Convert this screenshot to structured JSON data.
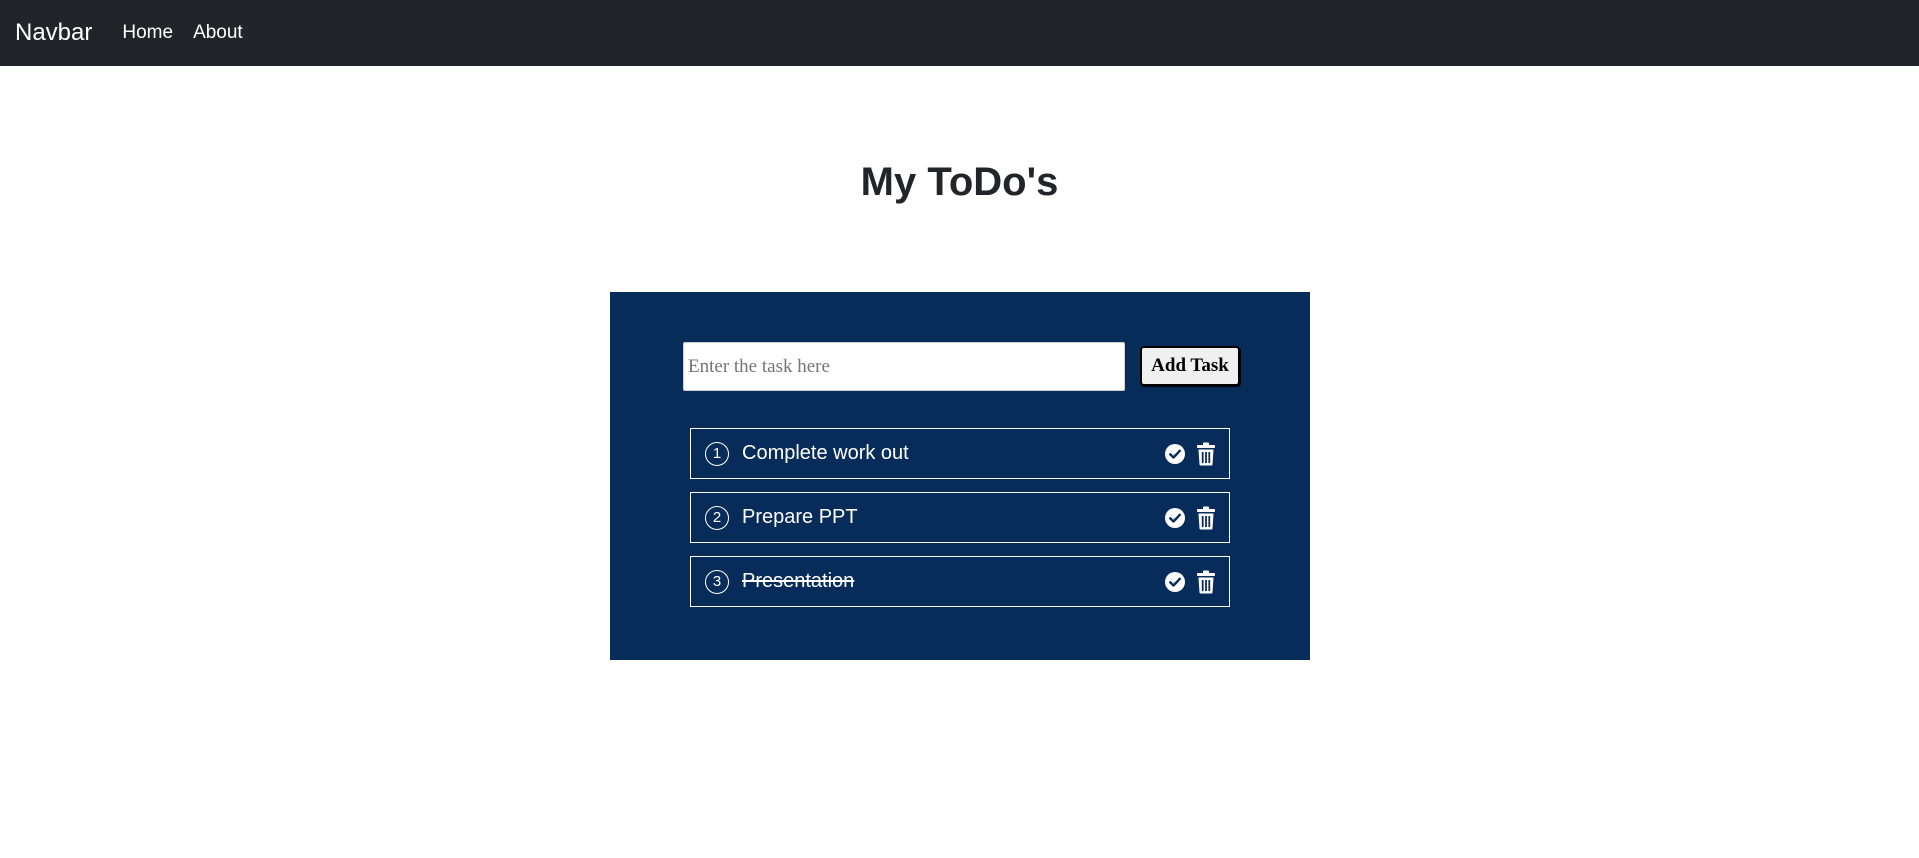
{
  "navbar": {
    "brand": "Navbar",
    "links": [
      "Home",
      "About"
    ],
    "background": "#212529"
  },
  "page": {
    "title": "My ToDo's"
  },
  "todo": {
    "panel_color": "#082c5a",
    "input": {
      "value": "",
      "placeholder": "Enter the task here"
    },
    "add_button_label": "Add Task",
    "tasks": [
      {
        "number": "1",
        "text": "Complete work out",
        "done": false
      },
      {
        "number": "2",
        "text": "Prepare PPT",
        "done": false
      },
      {
        "number": "3",
        "text": "Presentation",
        "done": true
      }
    ],
    "icons": {
      "complete": "check-circle-icon",
      "delete": "trash-icon"
    }
  }
}
